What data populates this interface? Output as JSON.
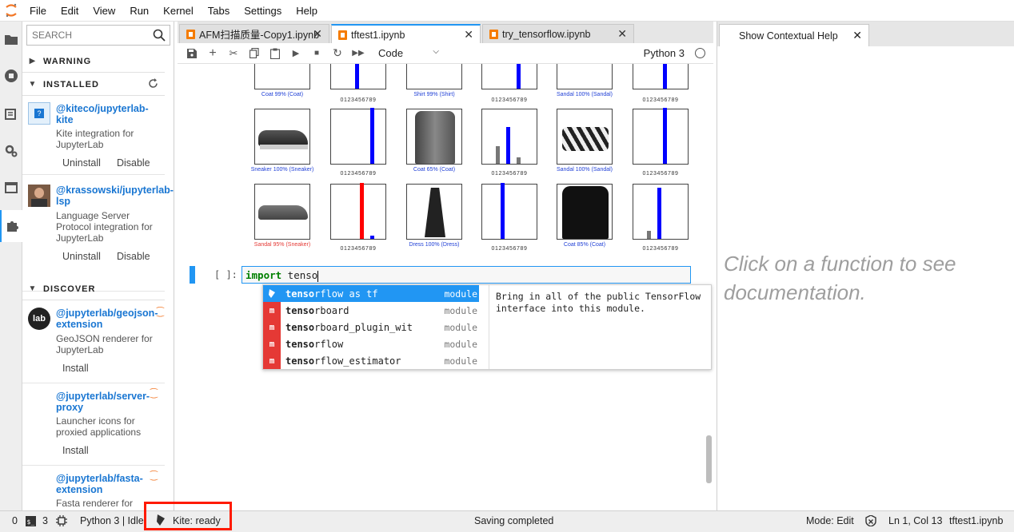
{
  "menubar": {
    "items": [
      "File",
      "Edit",
      "View",
      "Run",
      "Kernel",
      "Tabs",
      "Settings",
      "Help"
    ]
  },
  "sidebar": {
    "search_placeholder": "SEARCH",
    "sections": {
      "warning": "WARNING",
      "installed": "INSTALLED",
      "discover": "DISCOVER"
    },
    "installed": [
      {
        "name": "@kiteco/jupyterlab-kite",
        "description": "Kite integration for JupyterLab",
        "actions": [
          "Uninstall",
          "Disable"
        ]
      },
      {
        "name": "@krassowski/jupyterlab-lsp",
        "description": "Language Server Protocol integration for JupyterLab",
        "actions": [
          "Uninstall",
          "Disable"
        ]
      }
    ],
    "discover": [
      {
        "name": "@jupyterlab/geojson-extension",
        "description": "GeoJSON renderer for JupyterLab",
        "action": "Install",
        "icon_text": "lab"
      },
      {
        "name": "@jupyterlab/server-proxy",
        "description": "Launcher icons for proxied applications",
        "action": "Install"
      },
      {
        "name": "@jupyterlab/fasta-extension",
        "description": "Fasta renderer for"
      }
    ]
  },
  "tabs": [
    {
      "label": "AFM扫描质量-Copy1.ipynb",
      "active": false
    },
    {
      "label": "tftest1.ipynb",
      "active": true
    },
    {
      "label": "try_tensorflow.ipynb",
      "active": false
    }
  ],
  "toolbar": {
    "cell_type": "Code",
    "kernel": "Python 3"
  },
  "output_grid": {
    "ticks": "0123456789",
    "captions": [
      {
        "text": "Coat 99% (Coat)",
        "color": "#1f3fd6"
      },
      {
        "text": "Shirt 99% (Shirt)",
        "color": "#1f3fd6"
      },
      {
        "text": "Sandal 100% (Sandal)",
        "color": "#1f3fd6"
      },
      {
        "text": "Sneaker 100% (Sneaker)",
        "color": "#1f3fd6"
      },
      {
        "text": "Coat 65% (Coat)",
        "color": "#1f3fd6"
      },
      {
        "text": "Sandal 100% (Sandal)",
        "color": "#1f3fd6"
      },
      {
        "text": "Sandal 95% (Sneaker)",
        "color": "#e53935"
      },
      {
        "text": "Dress 100% (Dress)",
        "color": "#1f3fd6"
      },
      {
        "text": "Coat 85% (Coat)",
        "color": "#1f3fd6"
      }
    ]
  },
  "cell": {
    "prompt": "[ ]:",
    "keyword": "import",
    "text": " tenso"
  },
  "completer": {
    "items": [
      {
        "match": "tenso",
        "rest": "rflow as tf",
        "type": "module",
        "icon": "kite",
        "selected": true
      },
      {
        "match": "tenso",
        "rest": "rboard",
        "type": "module",
        "icon": "m",
        "selected": false
      },
      {
        "match": "tenso",
        "rest": "rboard_plugin_wit",
        "type": "module",
        "icon": "m",
        "selected": false
      },
      {
        "match": "tenso",
        "rest": "rflow",
        "type": "module",
        "icon": "m",
        "selected": false
      },
      {
        "match": "tenso",
        "rest": "rflow_estimator",
        "type": "module",
        "icon": "m",
        "selected": false
      }
    ],
    "doc": "Bring in all of the public TensorFlow interface into this module."
  },
  "help_panel": {
    "tab_label": "Show Contextual Help",
    "message": "Click on a function to see documentation."
  },
  "statusbar": {
    "terminals": "0",
    "kernels": "3",
    "kernel_status": "Python 3 | Idle",
    "kite_status": "Kite: ready",
    "save_status": "Saving completed",
    "mode": "Mode: Edit",
    "cursor": "Ln 1, Col 13",
    "file": "tftest1.ipynb"
  },
  "colors": {
    "accent": "#2196f3",
    "kite_highlight": "#ff1a00",
    "bar_correct": "#0000ff",
    "bar_wrong": "#ff0000",
    "bar_other": "#777777"
  }
}
